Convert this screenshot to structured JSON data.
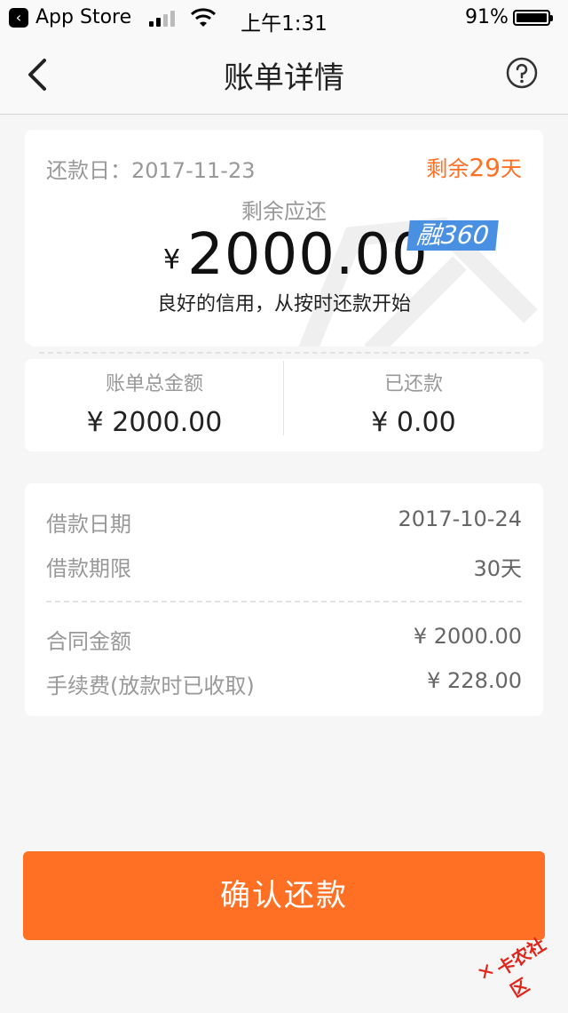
{
  "status_bar": {
    "back_app": "App Store",
    "time": "上午1:31",
    "battery": "91%"
  },
  "nav": {
    "title": "账单详情"
  },
  "summary": {
    "due_label": "还款日：",
    "due_date": "2017-11-23",
    "remaining_prefix": "剩余",
    "remaining_days": "29",
    "remaining_suffix": "天",
    "remain_label": "剩余应还",
    "currency": "¥",
    "amount": "2000.00",
    "brand": "融360",
    "slogan": "良好的信用，从按时还款开始",
    "total_label": "账单总金额",
    "total_value": "¥ 2000.00",
    "paid_label": "已还款",
    "paid_value": "¥ 0.00"
  },
  "details": {
    "rows": [
      {
        "label": "借款日期",
        "value": "2017-10-24"
      },
      {
        "label": "借款期限",
        "value": "30天"
      },
      {
        "label": "合同金额",
        "value": "¥ 2000.00"
      },
      {
        "label": "手续费(放款时已收取)",
        "value": "¥ 228.00"
      }
    ]
  },
  "confirm_button": "确认还款",
  "corner_stamp": "卡农社区",
  "colors": {
    "accent": "#ff7024",
    "badge": "#4a90e2"
  }
}
